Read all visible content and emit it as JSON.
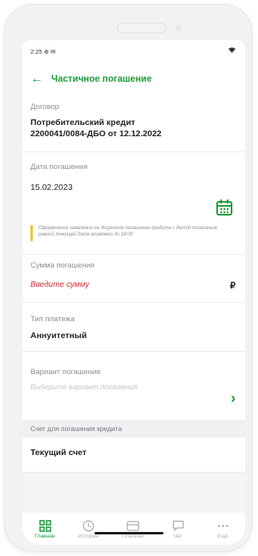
{
  "status_bar": {
    "time": "2:25",
    "icons_left": "⊕ ✉",
    "icon_right": "wifi-icon"
  },
  "header": {
    "back_icon": "arrow-left-icon",
    "title": "Частичное погашение"
  },
  "contract": {
    "label": "Договор",
    "line1": "Потребительский кредит",
    "line2": "2200041/0084-ДБО от 12.12.2022"
  },
  "payment_date": {
    "label": "Дата погашения",
    "value": "15.02.2023",
    "note": "Оформление заявления на досрочное погашение кредита с датой погашения равной текущей дате возможно до 18:00",
    "icon": "calendar-icon"
  },
  "amount": {
    "label": "Сумма погашения",
    "placeholder": "Введите сумму",
    "currency": "₽"
  },
  "payment_type": {
    "label": "Тип платежа",
    "value": "Аннуитетный"
  },
  "repay_option": {
    "label": "Вариант погашения",
    "placeholder": "Выберите вариант погашения"
  },
  "account_section": {
    "header": "Счет для погашения кредита",
    "value": "Текущий счет"
  },
  "tabs": [
    {
      "label": "Главная",
      "icon": "grid-icon",
      "active": true
    },
    {
      "label": "История",
      "icon": "clock-icon",
      "active": false
    },
    {
      "label": "Платежи",
      "icon": "card-icon",
      "active": false
    },
    {
      "label": "Чат",
      "icon": "chat-icon",
      "active": false
    },
    {
      "label": "Ещё",
      "icon": "more-icon",
      "active": false
    }
  ],
  "colors": {
    "accent": "#1e9b3a",
    "error": "#e0302f",
    "note_bar": "#f4c430"
  }
}
